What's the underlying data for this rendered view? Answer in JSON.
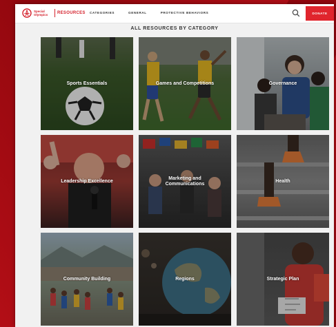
{
  "brand": {
    "logo_text": "Special Olympics",
    "section": "RESOURCES"
  },
  "nav": {
    "items": [
      {
        "label": "CATEGORIES"
      },
      {
        "label": "GENERAL"
      },
      {
        "label": "PROTECTIVE BEHAVIORS"
      }
    ]
  },
  "header": {
    "search_icon": "search-icon",
    "donate_label": "DONATE",
    "accent_color": "#e0252d"
  },
  "main": {
    "heading": "ALL RESOURCES BY CATEGORY",
    "categories": [
      {
        "label": "Sports Essentials"
      },
      {
        "label": "Games and Competitions"
      },
      {
        "label": "Governance"
      },
      {
        "label": "Leadership Excellence"
      },
      {
        "label": "Marketing and Communications"
      },
      {
        "label": "Health"
      },
      {
        "label": "Community Building"
      },
      {
        "label": "Regions"
      },
      {
        "label": "Strategic Plan"
      }
    ]
  }
}
